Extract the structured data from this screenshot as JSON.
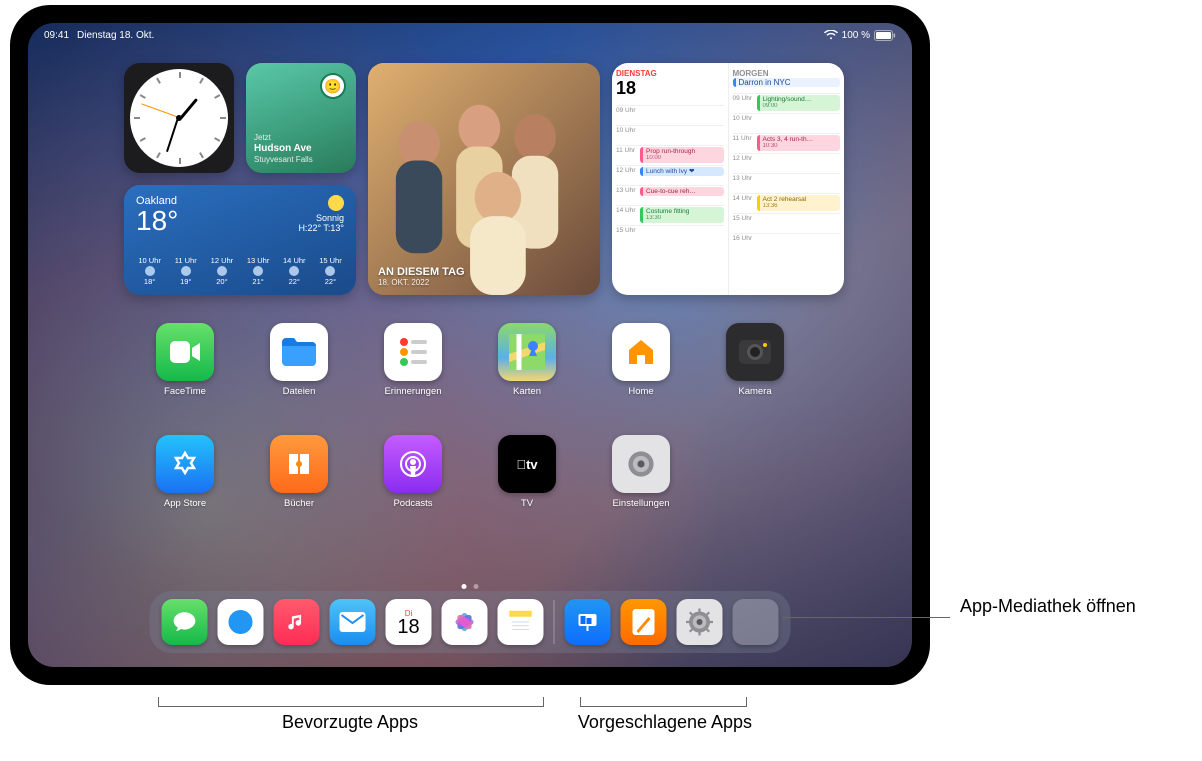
{
  "status": {
    "time": "09:41",
    "date": "Dienstag 18. Okt.",
    "battery": "100 %"
  },
  "widgets": {
    "findmy": {
      "now": "Jetzt",
      "place": "Hudson Ave",
      "area": "Stuyvesant Falls"
    },
    "weather": {
      "city": "Oakland",
      "temp": "18°",
      "cond": "Sonnig",
      "hilo": "H:22° T:13°",
      "hours": [
        {
          "t": "10 Uhr",
          "v": "18°"
        },
        {
          "t": "11 Uhr",
          "v": "19°"
        },
        {
          "t": "12 Uhr",
          "v": "20°"
        },
        {
          "t": "13 Uhr",
          "v": "21°"
        },
        {
          "t": "14 Uhr",
          "v": "22°"
        },
        {
          "t": "15 Uhr",
          "v": "22°"
        }
      ]
    },
    "photos": {
      "title": "AN DIESEM TAG",
      "date": "18. OKT. 2022"
    },
    "calendar": {
      "today_label": "DIENSTAG",
      "today_day": "18",
      "tomorrow_label": "MORGEN",
      "tomorrow_sub": "Darron in NYC",
      "today_events": [
        {
          "time": "11 Uhr",
          "title": "Prop run-through",
          "sub": "10:00",
          "cls": "pink"
        },
        {
          "time": "12 Uhr",
          "title": "Lunch with Ivy ❤",
          "sub": "",
          "cls": "blue"
        },
        {
          "time": "13 Uhr",
          "title": "Cue-to-cue reh…",
          "sub": "",
          "cls": "pink"
        },
        {
          "time": "14 Uhr",
          "title": "Costume fitting",
          "sub": "13:30",
          "cls": "green"
        }
      ],
      "tomorrow_events": [
        {
          "time": "09 Uhr",
          "title": "Lighting/sound…",
          "sub": "09:00",
          "cls": "green"
        },
        {
          "time": "11 Uhr",
          "title": "Acts 3, 4 run-th…",
          "sub": "10:30",
          "cls": "pink"
        },
        {
          "time": "14 Uhr",
          "title": "Act 2 rehearsal",
          "sub": "13:36",
          "cls": "yel"
        }
      ],
      "hours_left": [
        "09 Uhr",
        "10 Uhr",
        "11 Uhr",
        "12 Uhr",
        "13 Uhr",
        "14 Uhr",
        "15 Uhr"
      ],
      "hours_right": [
        "09 Uhr",
        "10 Uhr",
        "11 Uhr",
        "12 Uhr",
        "13 Uhr",
        "14 Uhr",
        "15 Uhr",
        "16 Uhr"
      ]
    }
  },
  "apps": {
    "row1": [
      {
        "id": "facetime",
        "label": "FaceTime"
      },
      {
        "id": "files",
        "label": "Dateien"
      },
      {
        "id": "reminders",
        "label": "Erinnerungen"
      },
      {
        "id": "maps",
        "label": "Karten"
      },
      {
        "id": "home",
        "label": "Home"
      },
      {
        "id": "camera",
        "label": "Kamera"
      }
    ],
    "row2": [
      {
        "id": "appstore",
        "label": "App Store"
      },
      {
        "id": "books",
        "label": "Bücher"
      },
      {
        "id": "podcasts",
        "label": "Podcasts"
      },
      {
        "id": "tv",
        "label": "TV"
      },
      {
        "id": "settings",
        "label": "Einstellungen"
      }
    ]
  },
  "dock": {
    "calendar_dow": "Di",
    "calendar_day": "18"
  },
  "callouts": {
    "applib": "App-Mediathek öffnen",
    "fav": "Bevorzugte Apps",
    "sugg": "Vorgeschlagene Apps"
  }
}
